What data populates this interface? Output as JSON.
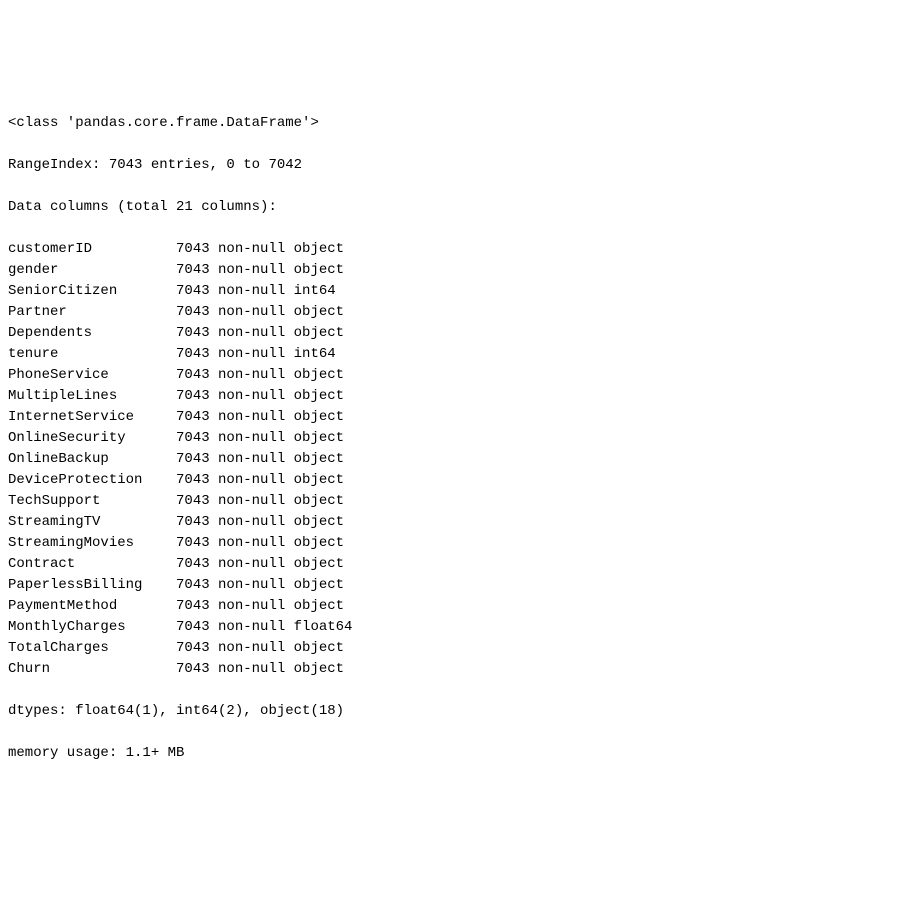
{
  "header": {
    "class_line": "<class 'pandas.core.frame.DataFrame'>",
    "range_index": "RangeIndex: 7043 entries, 0 to 7042",
    "data_columns": "Data columns (total 21 columns):"
  },
  "columns": [
    {
      "name": "customerID",
      "count": "7043",
      "null": "non-null",
      "dtype": "object"
    },
    {
      "name": "gender",
      "count": "7043",
      "null": "non-null",
      "dtype": "object"
    },
    {
      "name": "SeniorCitizen",
      "count": "7043",
      "null": "non-null",
      "dtype": "int64"
    },
    {
      "name": "Partner",
      "count": "7043",
      "null": "non-null",
      "dtype": "object"
    },
    {
      "name": "Dependents",
      "count": "7043",
      "null": "non-null",
      "dtype": "object"
    },
    {
      "name": "tenure",
      "count": "7043",
      "null": "non-null",
      "dtype": "int64"
    },
    {
      "name": "PhoneService",
      "count": "7043",
      "null": "non-null",
      "dtype": "object"
    },
    {
      "name": "MultipleLines",
      "count": "7043",
      "null": "non-null",
      "dtype": "object"
    },
    {
      "name": "InternetService",
      "count": "7043",
      "null": "non-null",
      "dtype": "object"
    },
    {
      "name": "OnlineSecurity",
      "count": "7043",
      "null": "non-null",
      "dtype": "object"
    },
    {
      "name": "OnlineBackup",
      "count": "7043",
      "null": "non-null",
      "dtype": "object"
    },
    {
      "name": "DeviceProtection",
      "count": "7043",
      "null": "non-null",
      "dtype": "object"
    },
    {
      "name": "TechSupport",
      "count": "7043",
      "null": "non-null",
      "dtype": "object"
    },
    {
      "name": "StreamingTV",
      "count": "7043",
      "null": "non-null",
      "dtype": "object"
    },
    {
      "name": "StreamingMovies",
      "count": "7043",
      "null": "non-null",
      "dtype": "object"
    },
    {
      "name": "Contract",
      "count": "7043",
      "null": "non-null",
      "dtype": "object"
    },
    {
      "name": "PaperlessBilling",
      "count": "7043",
      "null": "non-null",
      "dtype": "object"
    },
    {
      "name": "PaymentMethod",
      "count": "7043",
      "null": "non-null",
      "dtype": "object"
    },
    {
      "name": "MonthlyCharges",
      "count": "7043",
      "null": "non-null",
      "dtype": "float64"
    },
    {
      "name": "TotalCharges",
      "count": "7043",
      "null": "non-null",
      "dtype": "object"
    },
    {
      "name": "Churn",
      "count": "7043",
      "null": "non-null",
      "dtype": "object"
    }
  ],
  "footer": {
    "dtypes": "dtypes: float64(1), int64(2), object(18)",
    "memory": "memory usage: 1.1+ MB"
  }
}
